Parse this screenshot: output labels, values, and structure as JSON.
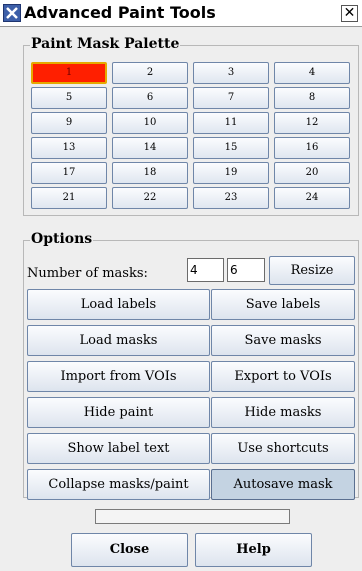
{
  "window": {
    "title": "Advanced Paint Tools",
    "close_glyph": "✕"
  },
  "palette": {
    "legend": "Paint Mask Palette",
    "selected_index": 0,
    "selected_color": "#ff1f00",
    "buttons": [
      "1",
      "2",
      "3",
      "4",
      "5",
      "6",
      "7",
      "8",
      "9",
      "10",
      "11",
      "12",
      "13",
      "14",
      "15",
      "16",
      "17",
      "18",
      "19",
      "20",
      "21",
      "22",
      "23",
      "24"
    ]
  },
  "options": {
    "legend": "Options",
    "num_masks_label": "Number of masks:",
    "rows_value": "4",
    "cols_value": "6",
    "resize_label": "Resize",
    "buttons": [
      [
        "Load labels",
        "Save labels"
      ],
      [
        "Load masks",
        "Save masks"
      ],
      [
        "Import from VOIs",
        "Export to VOIs"
      ],
      [
        "Hide paint",
        "Hide masks"
      ],
      [
        "Show label text",
        "Use shortcuts"
      ],
      [
        "Collapse masks/paint",
        "Autosave mask"
      ]
    ],
    "autosave_pressed": true
  },
  "progress": {
    "fraction": 0
  },
  "footer": {
    "close_label": "Close",
    "help_label": "Help"
  }
}
